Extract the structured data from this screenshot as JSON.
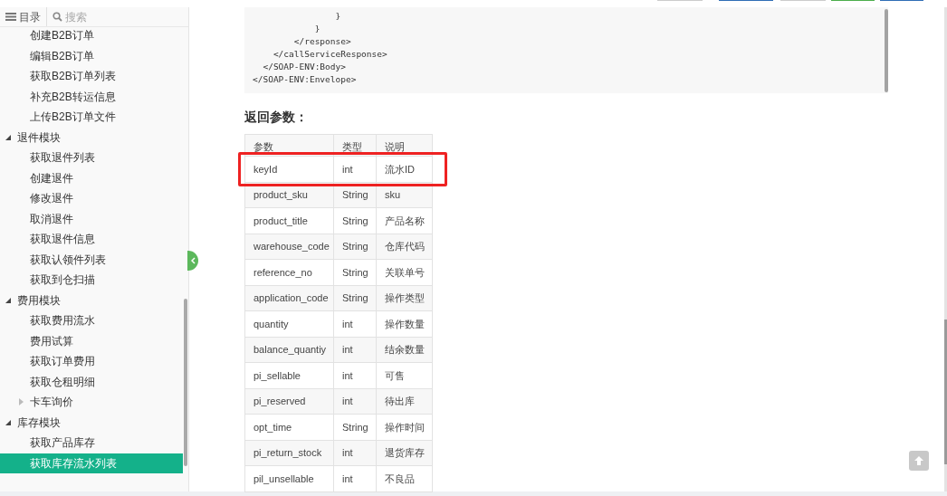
{
  "toolbar_buttons": [
    {
      "color": "#cccccc"
    },
    {
      "color": "#2f6db5"
    },
    {
      "color": "#cccccc"
    },
    {
      "color": "#4cae4c"
    },
    {
      "color": "#2f6db5"
    }
  ],
  "sidebar": {
    "toc_tab": "目录",
    "search_placeholder": "搜索",
    "items": [
      {
        "children": [
          {
            "label": "创建B2B订单",
            "selected": false
          },
          {
            "label": "编辑B2B订单",
            "selected": false
          },
          {
            "label": "获取B2B订单列表",
            "selected": false
          },
          {
            "label": "补充B2B转运信息",
            "selected": false
          },
          {
            "label": "上传B2B订单文件",
            "selected": false
          }
        ]
      },
      {
        "label": "退件模块",
        "expanded": true,
        "selected": false,
        "children": [
          {
            "label": "获取退件列表",
            "selected": false
          },
          {
            "label": "创建退件",
            "selected": false
          },
          {
            "label": "修改退件",
            "selected": false
          },
          {
            "label": "取消退件",
            "selected": false
          },
          {
            "label": "获取退件信息",
            "selected": false
          },
          {
            "label": "获取认领件列表",
            "selected": false
          },
          {
            "label": "获取到仓扫描",
            "selected": false
          }
        ]
      },
      {
        "label": "费用模块",
        "expanded": true,
        "selected": false,
        "children": [
          {
            "label": "获取费用流水",
            "selected": false
          },
          {
            "label": "费用试算",
            "selected": false
          },
          {
            "label": "获取订单费用",
            "selected": false
          },
          {
            "label": "获取仓租明细",
            "selected": false
          },
          {
            "label": "卡车询价",
            "expanded": false,
            "selected": false
          }
        ]
      },
      {
        "label": "库存模块",
        "expanded": true,
        "selected": false,
        "children": [
          {
            "label": "获取产品库存",
            "selected": false
          },
          {
            "label": "获取库存流水列表",
            "selected": true
          }
        ]
      }
    ]
  },
  "code_lines": [
    "                }",
    "            }",
    "        </response>",
    "    </callServiceResponse>",
    "  </SOAP-ENV:Body>",
    "</SOAP-ENV:Envelope>"
  ],
  "section_title": "返回参数：",
  "table": {
    "columns": [
      "参数",
      "类型",
      "说明"
    ],
    "rows": [
      {
        "cells": [
          "keyId",
          "int",
          "流水ID"
        ],
        "highlighted": true
      },
      {
        "cells": [
          "product_sku",
          "String",
          "sku"
        ],
        "highlighted": false
      },
      {
        "cells": [
          "product_title",
          "String",
          "产品名称"
        ],
        "highlighted": false
      },
      {
        "cells": [
          "warehouse_code",
          "String",
          "仓库代码"
        ],
        "highlighted": false
      },
      {
        "cells": [
          "reference_no",
          "String",
          "关联单号"
        ],
        "highlighted": false
      },
      {
        "cells": [
          "application_code",
          "String",
          "操作类型"
        ],
        "highlighted": false
      },
      {
        "cells": [
          "quantity",
          "int",
          "操作数量"
        ],
        "highlighted": false
      },
      {
        "cells": [
          "balance_quantiy",
          "int",
          "结余数量"
        ],
        "highlighted": false
      },
      {
        "cells": [
          "pi_sellable",
          "int",
          "可售"
        ],
        "highlighted": false
      },
      {
        "cells": [
          "pi_reserved",
          "int",
          "待出库"
        ],
        "highlighted": false
      },
      {
        "cells": [
          "opt_time",
          "String",
          "操作时间"
        ],
        "highlighted": false
      },
      {
        "cells": [
          "pi_return_stock",
          "int",
          "退货库存"
        ],
        "highlighted": false
      },
      {
        "cells": [
          "pil_unsellable",
          "int",
          "不良品"
        ],
        "highlighted": false
      }
    ]
  }
}
